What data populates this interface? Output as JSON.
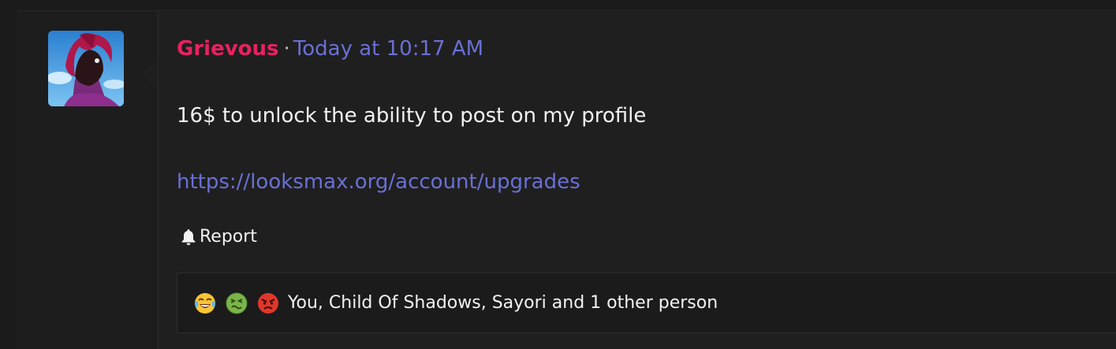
{
  "post": {
    "username": "Grievous",
    "separator": "·",
    "timestamp": "Today at 10:17 AM",
    "body_text": "16$ to unlock the ability to post on my profile",
    "body_link": "https://looksmax.org/account/upgrades",
    "report_label": "Report",
    "report_icon": "bell-icon",
    "reactions": {
      "icons": [
        "tears-of-joy-emoji",
        "nauseated-face-emoji",
        "angry-face-emoji"
      ],
      "summary": "You, Child Of Shadows, Sayori and 1 other person"
    }
  },
  "colors": {
    "username": "#e8225f",
    "link": "#6970d6",
    "text": "#f2f2f2",
    "background": "#1f1f1f"
  }
}
